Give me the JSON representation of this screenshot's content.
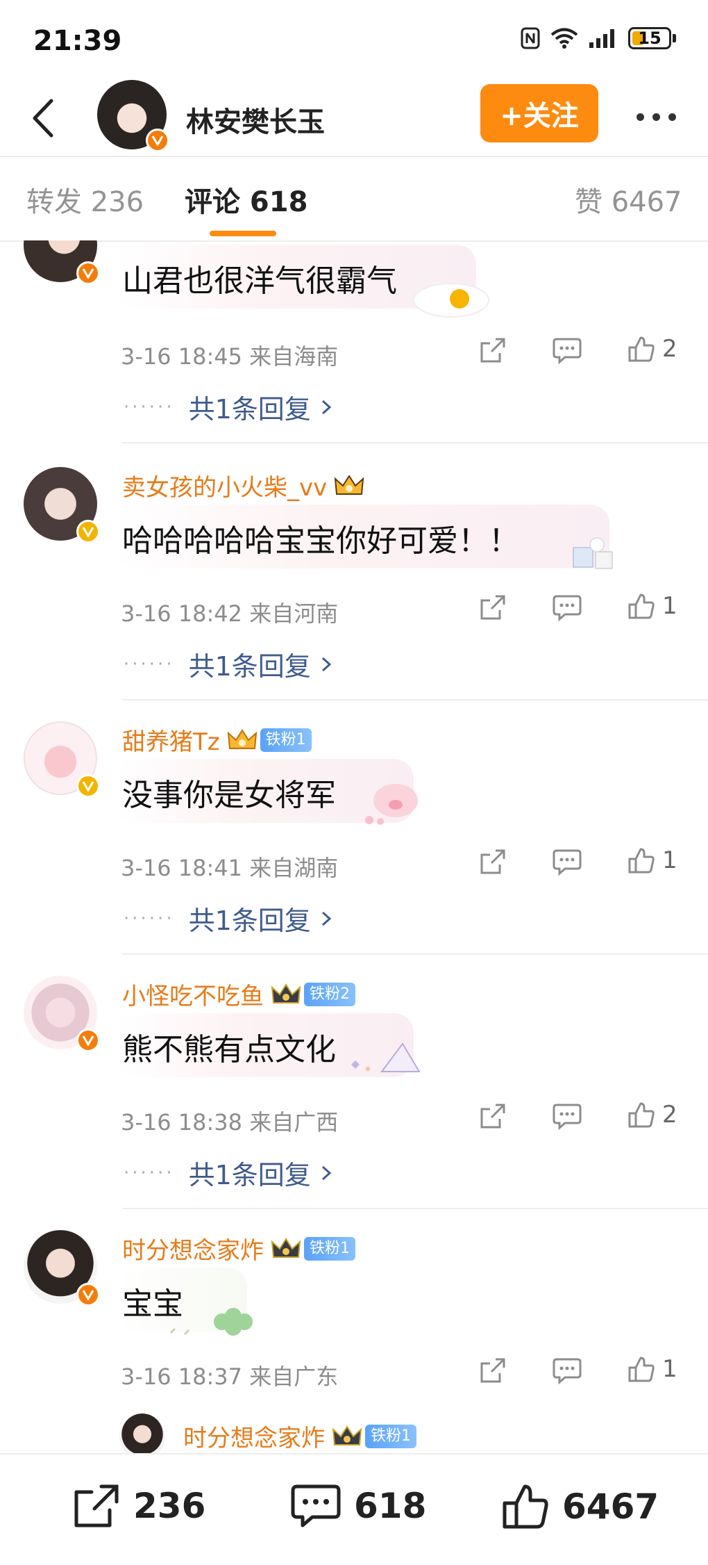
{
  "status_bar": {
    "time": "21:39",
    "battery": "15"
  },
  "header": {
    "name": "林安樊长玉",
    "follow_label": "+关注"
  },
  "tabs": [
    {
      "label": "转发 236"
    },
    {
      "label": "评论 618"
    },
    {
      "label": "赞 6467"
    }
  ],
  "comments": [
    {
      "name": "",
      "text": "山君也很洋气很霸气",
      "meta": "3-16 18:45  来自海南",
      "likes": "2",
      "reply": "共1条回复"
    },
    {
      "name": "卖女孩的小火柴_vv",
      "fan_badge": "",
      "text": "哈哈哈哈哈宝宝你好可爱！！",
      "meta": "3-16 18:42  来自河南",
      "likes": "1",
      "reply": "共1条回复"
    },
    {
      "name": "甜养猪Tz",
      "fan_badge": "铁粉1",
      "text": "没事你是女将军",
      "meta": "3-16 18:41  来自湖南",
      "likes": "1",
      "reply": "共1条回复"
    },
    {
      "name": "小怪吃不吃鱼",
      "fan_badge": "铁粉2",
      "text": "熊不熊有点文化",
      "meta": "3-16 18:38  来自广西",
      "likes": "2",
      "reply": "共1条回复"
    },
    {
      "name": "时分想念家炸",
      "fan_badge": "铁粉1",
      "text": "宝宝",
      "meta": "3-16 18:37  来自广东",
      "likes": "1",
      "reply": ""
    }
  ],
  "sub_comment": {
    "name": "时分想念家炸",
    "fan_badge": "铁粉1"
  },
  "bottom_bar": {
    "reposts": "236",
    "comments": "618",
    "likes": "6467"
  },
  "colors": {
    "accent": "#fd8b10",
    "username": "#e67b19",
    "reply_link": "#3f5b8e",
    "verified": "#f37d0a"
  },
  "icons": [
    "back-arrow-icon",
    "verified-icon",
    "more-icon",
    "share-icon",
    "comment-icon",
    "like-icon",
    "crown-icon",
    "chevron-right-icon",
    "nfc-icon",
    "wifi-icon",
    "signal-icon",
    "battery-icon"
  ]
}
